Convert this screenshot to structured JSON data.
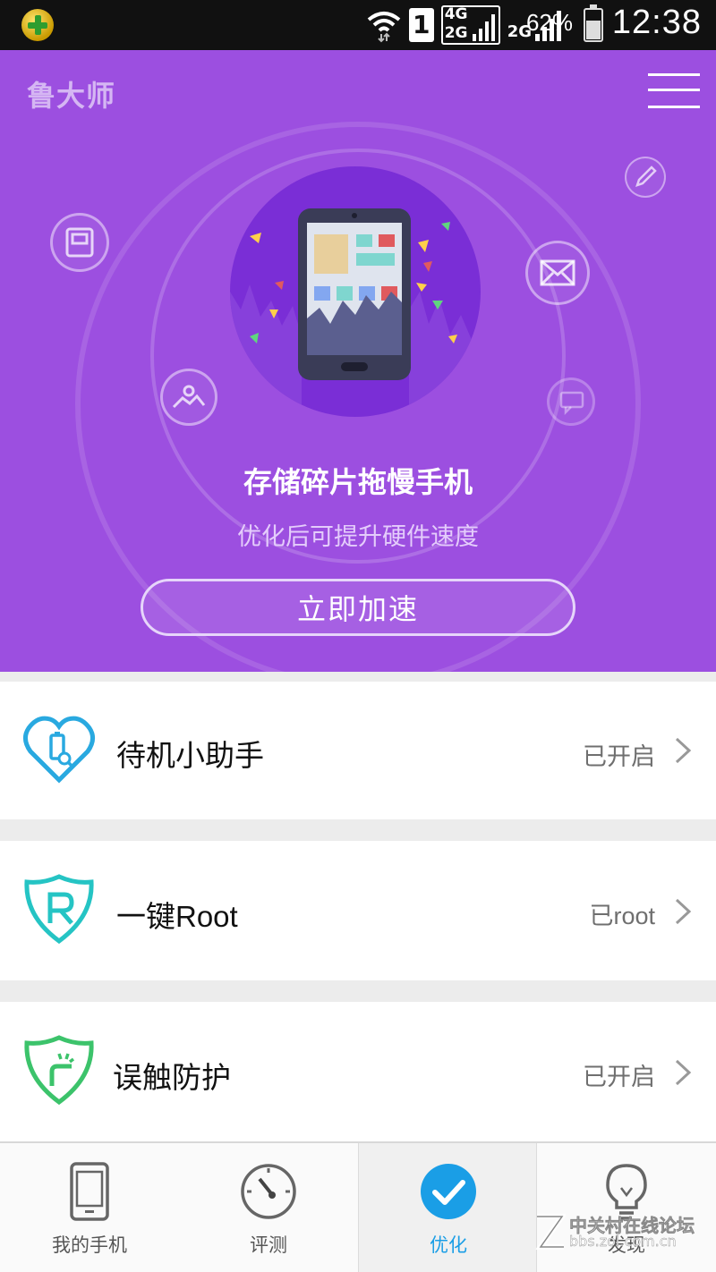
{
  "status_bar": {
    "carrier_icon": "360-plus-icon",
    "sim_slot": "1",
    "network_top": "4G",
    "network_bottom": "2G",
    "network_secondary": "2G",
    "battery_percent": "62%",
    "time": "12:38"
  },
  "header": {
    "app_title": "鲁大师",
    "menu_icon": "hamburger-menu-icon"
  },
  "hero": {
    "title": "存储碎片拖慢手机",
    "subtitle": "优化后可提升硬件速度",
    "action_label": "立即加速",
    "orbit_icons": [
      "book-icon",
      "image-icon",
      "mail-icon",
      "pencil-icon",
      "chat-icon"
    ],
    "colors": {
      "background": "#9c4fe0",
      "circle": "#7a2ed6"
    }
  },
  "list": {
    "items": [
      {
        "label": "待机小助手",
        "status": "已开启",
        "icon": "heart-battery-icon",
        "color": "#29a9e0"
      },
      {
        "label": "一键Root",
        "status": "已root",
        "icon": "shield-r-icon",
        "color": "#25c4c4"
      },
      {
        "label": "误触防护",
        "status": "已开启",
        "icon": "shield-touch-icon",
        "color": "#3cc36b"
      }
    ]
  },
  "tabbar": {
    "tabs": [
      {
        "label": "我的手机",
        "icon": "phone-icon",
        "active": false
      },
      {
        "label": "评测",
        "icon": "speedometer-icon",
        "active": false
      },
      {
        "label": "优化",
        "icon": "check-circle-icon",
        "active": true
      },
      {
        "label": "发现",
        "icon": "lightbulb-icon",
        "active": false
      }
    ],
    "active_color": "#1a9ee6"
  },
  "watermark": {
    "line1": "中关村在线论坛",
    "line2": "bbs.zol.com.cn"
  }
}
